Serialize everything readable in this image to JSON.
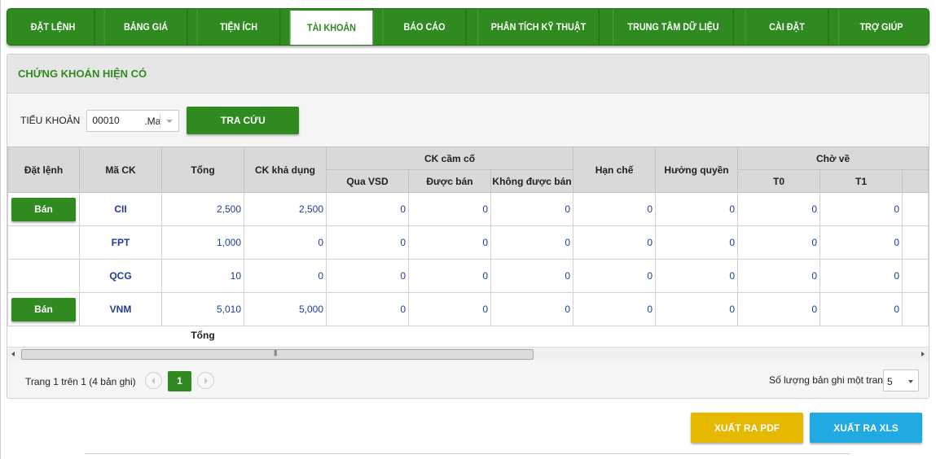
{
  "nav": {
    "tabs": [
      {
        "label": "ĐẶT LỆNH",
        "active": false
      },
      {
        "label": "BẢNG GIÁ",
        "active": false
      },
      {
        "label": "TIỆN ÍCH",
        "active": false
      },
      {
        "label": "TÀI KHOẢN",
        "active": true
      },
      {
        "label": "BÁO CÁO",
        "active": false
      },
      {
        "label": "PHÂN TÍCH KỸ THUẬT",
        "active": false
      },
      {
        "label": "TRUNG TÂM DỮ LIỆU",
        "active": false
      },
      {
        "label": "CÀI ĐẶT",
        "active": false
      },
      {
        "label": "TRỢ GIÚP",
        "active": false
      }
    ]
  },
  "panel": {
    "title": "CHỨNG KHOÁN HIỆN CÓ",
    "sub_account_label": "TIỂU KHOẢN",
    "sub_account_value": "00010",
    "sub_account_suffix": ".Ma",
    "search_button": "TRA CỨU"
  },
  "table": {
    "headers": {
      "order": "Đặt lệnh",
      "symbol": "Mã CK",
      "total": "Tổng",
      "available": "CK khả dụng",
      "pledged": "CK cầm cố",
      "pledged_vsd": "Qua VSD",
      "pledged_sellable": "Được bán",
      "pledged_not_sellable": "Không được bán",
      "restricted": "Hạn chế",
      "rights": "Hưởng quyền",
      "pending": "Chờ về",
      "t0": "T0",
      "t1": "T1"
    },
    "rows": [
      {
        "action": "Bán",
        "symbol": "CII",
        "total": "2,500",
        "available": "2,500",
        "vsd": "0",
        "sellable": "0",
        "not_sellable": "0",
        "restricted": "0",
        "rights": "0",
        "t0": "0",
        "t1": "0"
      },
      {
        "action": "",
        "symbol": "FPT",
        "total": "1,000",
        "available": "0",
        "vsd": "0",
        "sellable": "0",
        "not_sellable": "0",
        "restricted": "0",
        "rights": "0",
        "t0": "0",
        "t1": "0"
      },
      {
        "action": "",
        "symbol": "QCG",
        "total": "10",
        "available": "0",
        "vsd": "0",
        "sellable": "0",
        "not_sellable": "0",
        "restricted": "0",
        "rights": "0",
        "t0": "0",
        "t1": "0"
      },
      {
        "action": "Bán",
        "symbol": "VNM",
        "total": "5,010",
        "available": "5,000",
        "vsd": "0",
        "sellable": "0",
        "not_sellable": "0",
        "restricted": "0",
        "rights": "0",
        "t0": "0",
        "t1": "0"
      }
    ],
    "total_label": "Tổng"
  },
  "pager": {
    "info": "Trang 1 trên 1 (4 bản ghi)",
    "current_page": "1",
    "per_page_label": "Số lượng bản ghi một trang",
    "per_page_value": "5"
  },
  "export": {
    "pdf": "XUẤT RA PDF",
    "xls": "XUẤT RA XLS"
  },
  "colors": {
    "brand_green": "#2f8a1f",
    "pdf_yellow": "#e6b800",
    "xls_blue": "#20a9e3",
    "value_blue": "#1f3d99"
  }
}
